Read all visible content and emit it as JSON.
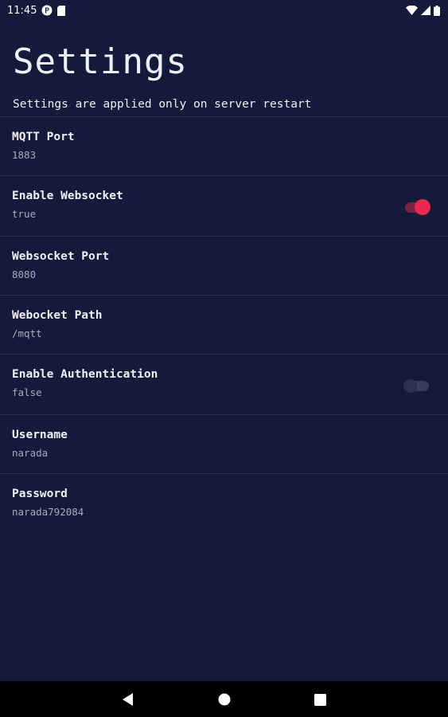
{
  "status_bar": {
    "time": "11:45",
    "icons_left": [
      "notification-p-icon",
      "sim-card-icon"
    ],
    "icons_right": [
      "wifi-icon",
      "cellular-signal-icon",
      "battery-icon"
    ]
  },
  "header": {
    "title": "Settings",
    "subtitle": "Settings are applied only on server restart"
  },
  "settings": [
    {
      "label": "MQTT Port",
      "value": "1883"
    },
    {
      "label": "Enable Websocket",
      "value": "true",
      "toggle": "on"
    },
    {
      "label": "Websocket Port",
      "value": "8080"
    },
    {
      "label": "Webocket Path",
      "value": "/mqtt"
    },
    {
      "label": "Enable Authentication",
      "value": "false",
      "toggle": "off"
    },
    {
      "label": "Username",
      "value": "narada"
    },
    {
      "label": "Password",
      "value": "narada792084"
    }
  ],
  "nav_bar": {
    "buttons": [
      "back-icon",
      "home-icon",
      "recents-icon"
    ]
  },
  "colors": {
    "background": "#141b3a",
    "accent": "#e8294f",
    "divider": "#2a3156",
    "text_primary": "#eef0f7",
    "text_secondary": "#a4aac2"
  }
}
